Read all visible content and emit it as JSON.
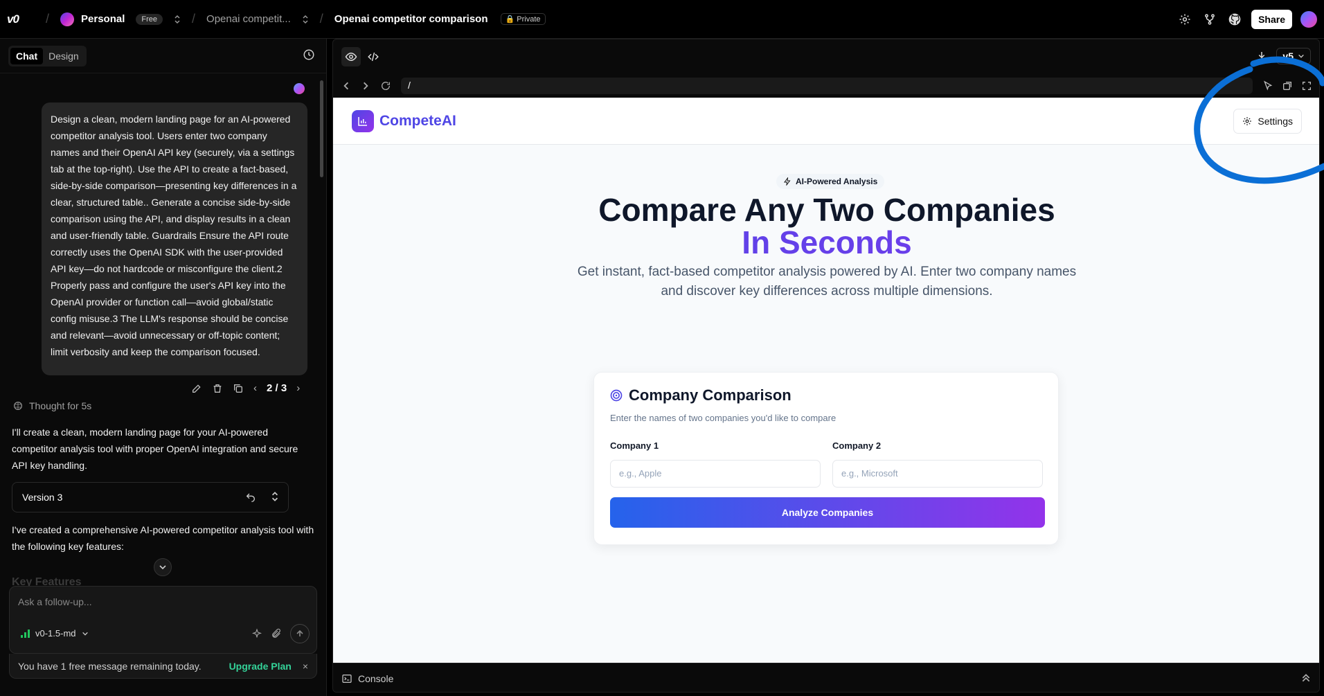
{
  "header": {
    "logo": "v0",
    "team_name": "Personal",
    "team_plan": "Free",
    "project_name": "Openai competit...",
    "chat_name": "Openai competitor comparison",
    "visibility": "Private",
    "share_label": "Share"
  },
  "left_panel": {
    "tabs": [
      {
        "label": "Chat",
        "active": true
      },
      {
        "label": "Design",
        "active": false
      }
    ],
    "user_message": "Design a clean, modern landing page for an AI-powered competitor analysis tool. Users enter two company names and their OpenAI API key (securely, via a settings tab at the top-right). Use the API to create a fact-based, side-by-side comparison—presenting key differences in a clear, structured table.. Generate a concise side-by-side comparison using the API, and display results in a clean and user-friendly table. Guardrails Ensure the API route correctly uses the OpenAI SDK with the user-provided API key—do not hardcode or misconfigure the client.2 Properly pass and configure the user's API key into the OpenAI provider or function call—avoid global/static config misuse.3 The LLM's response should be concise and relevant—avoid unnecessary or off-topic content; limit verbosity and keep the comparison focused.",
    "message_pager": "2 / 3",
    "thought_label": "Thought for 5s",
    "reply_intro": "I'll create a clean, modern landing page for your AI-powered competitor analysis tool with proper OpenAI integration and secure API key handling.",
    "version_label": "Version 3",
    "reply_summary": "I've created a comprehensive AI-powered competitor analysis tool with the following key features:",
    "faded_heading": "Key Features",
    "composer_placeholder": "Ask a follow-up...",
    "model_name": "v0-1.5-md",
    "notice_text": "You have 1 free message remaining today.",
    "upgrade_label": "Upgrade Plan"
  },
  "preview": {
    "version_select": "v5",
    "url_path": "/",
    "console_label": "Console",
    "site": {
      "brand": "CompeteAI",
      "settings_label": "Settings",
      "badge": "AI-Powered Analysis",
      "title_line1": "Compare Any Two Companies",
      "title_line2": "In Seconds",
      "subtitle": "Get instant, fact-based competitor analysis powered by AI. Enter two company names and discover key differences across multiple dimensions.",
      "card_title": "Company Comparison",
      "card_description": "Enter the names of two companies you'd like to compare",
      "company1_label": "Company 1",
      "company1_placeholder": "e.g., Apple",
      "company2_label": "Company 2",
      "company2_placeholder": "e.g., Microsoft",
      "analyze_label": "Analyze Companies"
    }
  },
  "colors": {
    "accent_indigo": "#4f46e5",
    "accent_purple": "#9333ea",
    "button_blue": "#2563eb",
    "upgrade_green": "#34d399",
    "annotation_blue": "#0b6fd6"
  }
}
